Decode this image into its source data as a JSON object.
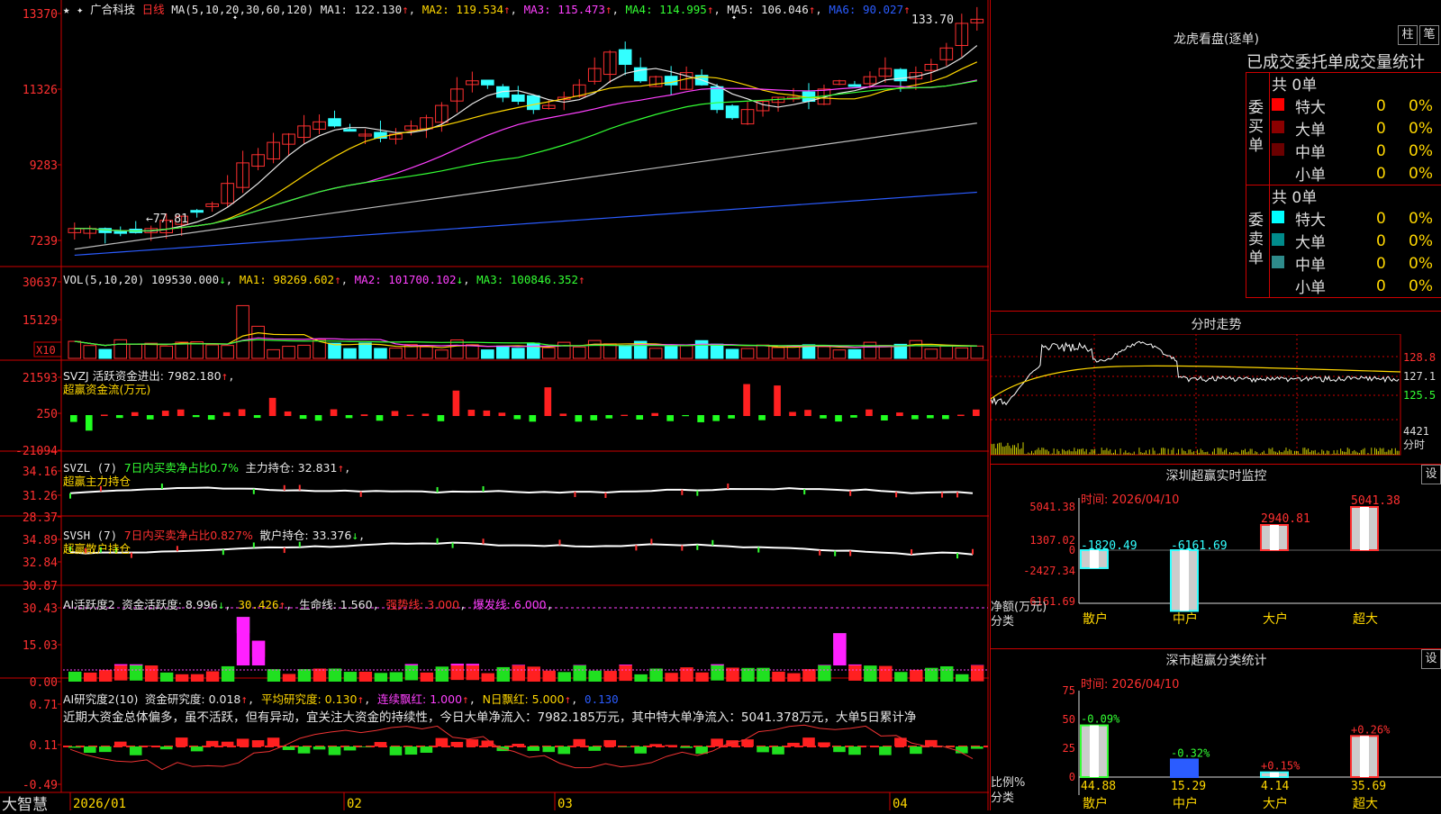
{
  "stock": {
    "name": "广合科技",
    "period": "日线"
  },
  "ma": {
    "label": "MA(5,10,20,30,60,120)",
    "ma1": "MA1: 122.130",
    "ma2": "MA2: 119.534",
    "ma3": "MA3: 115.473",
    "ma4": "MA4: 114.995",
    "ma5": "MA5: 106.046",
    "ma6": "MA6: 90.027"
  },
  "price_axis": [
    "13370",
    "11326",
    "9283",
    "7239"
  ],
  "price_marks": {
    "high": "133.70",
    "low": "77.81"
  },
  "vol": {
    "label": "VOL(5,10,20)",
    "value": "109530.000",
    "ma1": "MA1: 98269.602",
    "ma2": "MA2: 101700.102",
    "ma3": "MA3: 100846.352",
    "axis": [
      "30637",
      "15129"
    ],
    "unit": "X10"
  },
  "svzj": {
    "label": "SVZJ  活跃资金进出: 7982.180",
    "sub": "超赢资金流(万元)",
    "axis": [
      "21593",
      "250",
      "-21094"
    ]
  },
  "svzl": {
    "label": "SVZL (7)",
    "pct": "7日内买卖净占比0.7%",
    "hold": "主力持仓: 32.831",
    "sub": "超赢主力持仓",
    "axis": [
      "34.16",
      "31.26",
      "28.37"
    ]
  },
  "svsh": {
    "label": "SVSH (7)",
    "pct": "7日内买卖净占比0.827%",
    "hold": "散户持仓: 33.376",
    "sub": "超赢散户持仓",
    "axis": [
      "34.89",
      "32.84",
      "30.87"
    ]
  },
  "ai2": {
    "label": "AI活跃度2",
    "a": "资金活跃度: 8.996",
    "b": "30.426",
    "c": "生命线: 1.560",
    "d": "强势线: 3.000",
    "e": "爆发线: 6.000",
    "axis": [
      "30.43",
      "15.03",
      "0.00"
    ]
  },
  "ai_r": {
    "label": "AI研究度2(10)",
    "a": "资金研究度: 0.018",
    "b": "平均研究度: 0.130",
    "c": "连续飘红: 1.000",
    "d": "N日飘红: 5.000",
    "e": "0.130",
    "comment": "近期大资金总体偏多，虽不活跃，但有异动，宜关注大资金的持续性，今日大单净流入：7982.185万元，其中特大单净流入：5041.378万元，大单5日累计净",
    "axis": [
      "0.71",
      "0.11",
      "-0.49"
    ]
  },
  "dates": [
    "2026/01",
    "02",
    "03",
    "04"
  ],
  "brand": "大智慧",
  "lhb": {
    "title": "龙虎看盘(逐单)",
    "btn1": "柱",
    "btn2": "笔",
    "tabs": "已成交委托单成交量统计",
    "buy_label": "委买单",
    "sell_label": "委卖单",
    "total": "共 0单",
    "rows": [
      {
        "name": "特大",
        "v": "0",
        "p": "0%"
      },
      {
        "name": "大单",
        "v": "0",
        "p": "0%"
      },
      {
        "name": "中单",
        "v": "0",
        "p": "0%"
      },
      {
        "name": "小单",
        "v": "0",
        "p": "0%"
      }
    ],
    "buy_colors": [
      "#ff0000",
      "#8b0000",
      "#6b0000"
    ],
    "sell_colors": [
      "#00ffff",
      "#008b8b",
      "#2e8b8b"
    ]
  },
  "intraday": {
    "title": "分时走势",
    "axis": [
      "128.8",
      "127.1",
      "125.5"
    ],
    "vol": "4421",
    "vol_unit": "分时"
  },
  "monitor": {
    "title": "深圳超赢实时监控",
    "btn": "设",
    "time": "时间: 2026/04/10",
    "axis": [
      "5041.38",
      "1307.02",
      "0",
      "-2427.34",
      "-6161.69"
    ],
    "ylabel": "净额(万元)",
    "xlabel": "分类",
    "cats": [
      "散户",
      "中户",
      "大户",
      "超大"
    ],
    "values": [
      -1820.49,
      -6161.69,
      2940.81,
      5041.38
    ],
    "labels": [
      "-1820.49",
      "-6161.69",
      "2940.81",
      "5041.38"
    ]
  },
  "stats": {
    "title": "深市超赢分类统计",
    "btn": "设",
    "time": "时间: 2026/04/10",
    "axis": [
      "75",
      "50",
      "25",
      "0"
    ],
    "ylabel": "比例%",
    "xlabel": "分类",
    "cats": [
      "散户",
      "中户",
      "大户",
      "超大"
    ],
    "values": [
      44.88,
      15.29,
      4.14,
      35.69
    ],
    "vals": [
      "44.88",
      "15.29",
      "4.14",
      "35.69"
    ],
    "changes": [
      "-0.09%",
      "-0.32%",
      "+0.15%",
      "+0.26%"
    ]
  }
}
